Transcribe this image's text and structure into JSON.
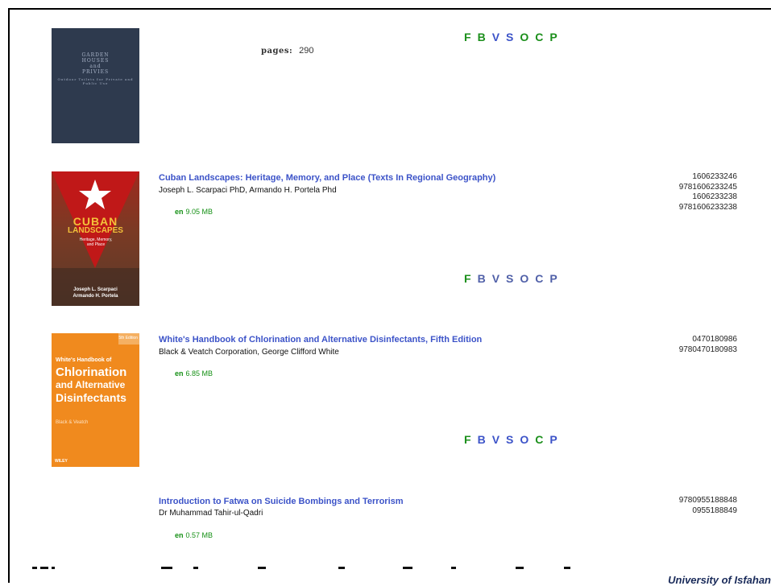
{
  "colors": {
    "title_blue": "#3c53c8",
    "green": "#1b8f1b",
    "gray_blue": "#5060a8"
  },
  "format_legend": [
    "F",
    "B",
    "V",
    "S",
    "O",
    "C",
    "P"
  ],
  "books": [
    {
      "cover": {
        "lines": [
          "GARDEN",
          "HOUSES",
          "and",
          "PRIVIES"
        ],
        "small": "Outdoor Toilets for Private and Public Use"
      },
      "pages_label": "pages:",
      "pages_value": "290"
    },
    {
      "title": "Cuban Landscapes: Heritage, Memory, and Place (Texts In Regional Geography)",
      "authors": "Joseph L. Scarpaci PhD, Armando H. Portela Phd",
      "lang": "en",
      "size": "9.05 MB",
      "isbns": [
        "1606233246",
        "9781606233245",
        "1606233238",
        "9781606233238"
      ],
      "cover": {
        "line1": "CUBAN",
        "line2": "LANDSCAPES",
        "sub": "Heritage, Memory, and Place",
        "authors": "Joseph L. Scarpaci\nArmando H. Portela"
      }
    },
    {
      "title": "White's Handbook of Chlorination and Alternative Disinfectants, Fifth Edition",
      "authors": "Black & Veatch Corporation, George Clifford White",
      "lang": "en",
      "size": "6.85 MB",
      "isbns": [
        "0470180986",
        "9780470180983"
      ],
      "cover": {
        "small": "White's Handbook of",
        "big1": "Chlorination",
        "big2": "and Alternative",
        "big3": "Disinfectants",
        "edition": "5th Edition",
        "author": "Black & Veatch",
        "publisher": "WILEY"
      }
    },
    {
      "title": "Introduction to Fatwa on Suicide Bombings and Terrorism",
      "authors": "Dr Muhammad Tahir-ul-Qadri",
      "lang": "en",
      "size": "0.57 MB",
      "isbns": [
        "9780955188848",
        "0955188849"
      ]
    }
  ],
  "footer": {
    "university": "University of Isfahan"
  }
}
